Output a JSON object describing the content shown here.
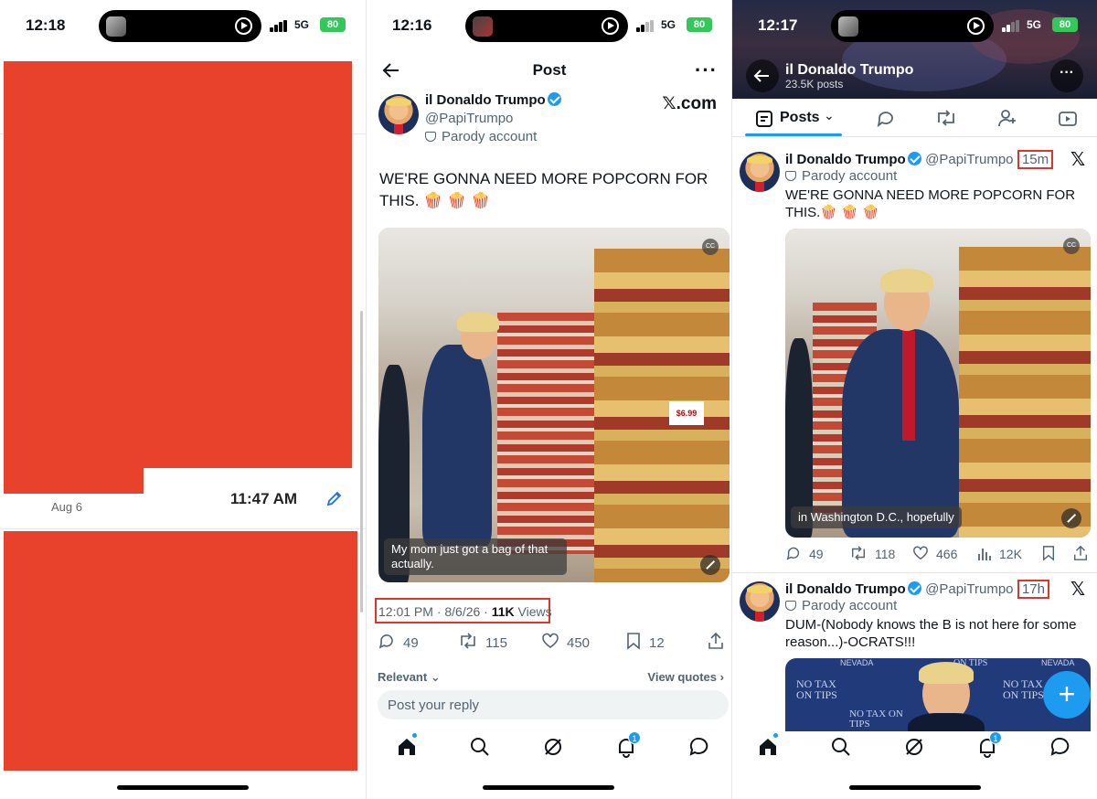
{
  "panel1": {
    "status": {
      "time": "12:18",
      "network": "5G",
      "battery": "80"
    },
    "message": {
      "date": "Aug 6",
      "time": "11:47 AM"
    }
  },
  "panel2": {
    "status": {
      "time": "12:16",
      "network": "5G",
      "battery": "80"
    },
    "header": {
      "title": "Post"
    },
    "author": {
      "name": "il Donaldo Trumpo",
      "handle": "@PapiTrumpo",
      "badge": "Parody account"
    },
    "source_logo": "𝕏.com",
    "tweet_text": "WE'RE GONNA NEED MORE POPCORN FOR THIS. 🍿 🍿 🍿",
    "video_caption": "My mom just got a bag of that actually.",
    "video_price_tag": "$6.99",
    "meta": {
      "time_date": "12:01 PM · 8/6/26 · ",
      "views_count": "11K",
      "views_label": " Views"
    },
    "stats": {
      "replies": "49",
      "reposts": "115",
      "likes": "450",
      "bookmarks": "12"
    },
    "sort": {
      "relevant": "Relevant",
      "view_quotes": "View quotes"
    },
    "reply_placeholder": "Post your reply",
    "notif_count": "1"
  },
  "panel3": {
    "status": {
      "time": "12:17",
      "network": "5G",
      "battery": "80"
    },
    "profile": {
      "name": "il Donaldo Trumpo",
      "post_count": "23.5K posts"
    },
    "tabs": {
      "posts": "Posts"
    },
    "posts": [
      {
        "name": "il Donaldo Trumpo",
        "handle": "@PapiTrumpo",
        "time": "15m",
        "badge": "Parody account",
        "text": "WE'RE GONNA NEED MORE POPCORN FOR THIS.🍿 🍿 🍿",
        "video_caption": "in Washington D.C., hopefully",
        "stats": {
          "replies": "49",
          "reposts": "118",
          "likes": "466",
          "views": "12K"
        }
      },
      {
        "name": "il Donaldo Trumpo",
        "handle": "@PapiTrumpo",
        "time": "17h",
        "badge": "Parody account",
        "text": "DUM-(Nobody knows the B is not here for some reason...)-OCRATS!!!",
        "image_text": [
          "NO TAX ON TIPS",
          "NO TAX ON TIPS",
          "NO TAX ON TIPS",
          "NEVADA",
          "NEVADA",
          "ON TIPS"
        ]
      }
    ],
    "notif_count": "1",
    "fab_label": "+"
  },
  "colors": {
    "accent": "#1d9bf0",
    "redaction": "#e8412c",
    "highlight_box": "#e0342a",
    "battery": "#34c759"
  },
  "icons": [
    "back-arrow-icon",
    "more-icon",
    "verified-icon",
    "parody-mask-icon",
    "reply-icon",
    "repost-icon",
    "like-icon",
    "bookmark-icon",
    "share-icon",
    "home-icon",
    "search-icon",
    "grok-icon",
    "bell-icon",
    "messages-icon",
    "x-logo-icon",
    "plus-icon",
    "edit-icon"
  ]
}
